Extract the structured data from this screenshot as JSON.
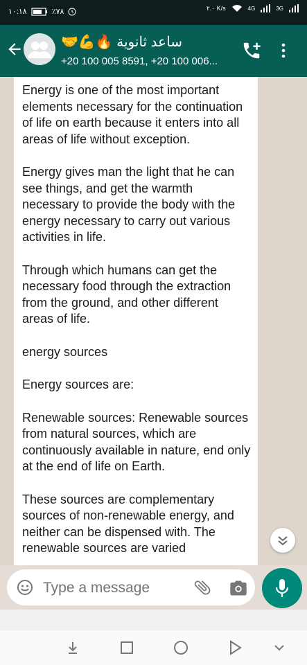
{
  "status_bar": {
    "time": "١٠:١٨",
    "battery": "٪٧٨",
    "speed": "٢.٠ K/s",
    "network_4g": "4G",
    "network_3g": "3G"
  },
  "header": {
    "group_name": "ساعد ثانوية 🔥💪🤝",
    "participants": "+20 100 005 8591, +20 100 006..."
  },
  "message": {
    "paragraphs": [
      "Energy is one of the most important elements necessary for the continuation of life on earth because it enters into all areas of life without exception.",
      "Energy gives man the light that he can see things, and get the warmth necessary to provide the body with the energy necessary to carry out various activities in life.",
      "Through which humans can get the necessary food through the extraction from the ground, and other different areas of life.",
      "energy sources",
      "Energy sources are:",
      "Renewable sources:  Renewable sources from natural sources, which are continuously available in nature, end only at the end of life on Earth.",
      "These sources are complementary sources of non-renewable energy, and neither can be dispensed with. The renewable sources are varied"
    ]
  },
  "composer": {
    "placeholder": "Type a message"
  },
  "colors": {
    "header": "#075e54",
    "mic": "#00897b"
  },
  "icons": [
    "back-arrow-icon",
    "group-avatar-icon",
    "add-call-icon",
    "menu-icon",
    "scroll-down-icon",
    "emoji-icon",
    "attach-icon",
    "camera-icon",
    "mic-icon",
    "nav-down-icon",
    "nav-square-icon",
    "nav-circle-icon",
    "nav-triangle-icon",
    "nav-chevron-icon"
  ]
}
